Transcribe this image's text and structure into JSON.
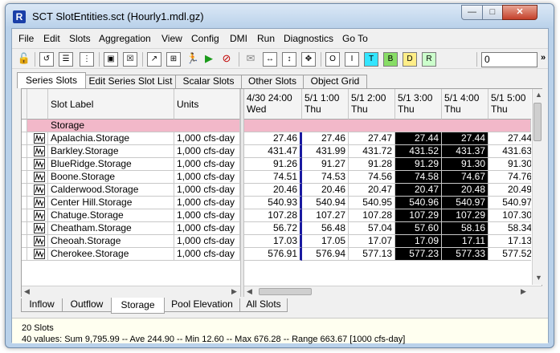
{
  "window": {
    "title": "SCT SlotEntities.sct (Hourly1.mdl.gz)"
  },
  "menu": [
    "File",
    "Edit",
    "Slots",
    "Aggregation",
    "View",
    "Config",
    "DMI",
    "Run",
    "Diagnostics",
    "Go To"
  ],
  "toolbar": {
    "input_value": "0",
    "letter_buttons": [
      "O",
      "I",
      "T",
      "B",
      "D",
      "R"
    ],
    "letter_colors": [
      "#ffffff",
      "#ffffff",
      "#33e5ff",
      "#88dd66",
      "#ffee88",
      "#ccffcc"
    ]
  },
  "top_tabs": [
    "Series Slots",
    "Edit Series Slot List",
    "Scalar Slots",
    "Other Slots",
    "Object Grid"
  ],
  "active_top_tab": "Series Slots",
  "grid": {
    "col_slot_label": "Slot Label",
    "col_units": "Units",
    "group_label": "Storage",
    "columns": [
      {
        "date": "4/30 24:00",
        "day": "Wed"
      },
      {
        "date": "5/1 1:00",
        "day": "Thu"
      },
      {
        "date": "5/1 2:00",
        "day": "Thu"
      },
      {
        "date": "5/1 3:00",
        "day": "Thu"
      },
      {
        "date": "5/1 4:00",
        "day": "Thu"
      },
      {
        "date": "5/1 5:00",
        "day": "Thu"
      }
    ],
    "rows": [
      {
        "label": "Apalachia.Storage",
        "units": "1,000 cfs-day",
        "values": [
          "27.46",
          "27.46",
          "27.47",
          "27.44",
          "27.44",
          "27.44"
        ]
      },
      {
        "label": "Barkley.Storage",
        "units": "1,000 cfs-day",
        "values": [
          "431.47",
          "431.99",
          "431.72",
          "431.52",
          "431.37",
          "431.63"
        ]
      },
      {
        "label": "BlueRidge.Storage",
        "units": "1,000 cfs-day",
        "values": [
          "91.26",
          "91.27",
          "91.28",
          "91.29",
          "91.30",
          "91.30"
        ]
      },
      {
        "label": "Boone.Storage",
        "units": "1,000 cfs-day",
        "values": [
          "74.51",
          "74.53",
          "74.56",
          "74.58",
          "74.67",
          "74.76"
        ]
      },
      {
        "label": "Calderwood.Storage",
        "units": "1,000 cfs-day",
        "values": [
          "20.46",
          "20.46",
          "20.47",
          "20.47",
          "20.48",
          "20.49"
        ]
      },
      {
        "label": "Center Hill.Storage",
        "units": "1,000 cfs-day",
        "values": [
          "540.93",
          "540.94",
          "540.95",
          "540.96",
          "540.97",
          "540.97"
        ]
      },
      {
        "label": "Chatuge.Storage",
        "units": "1,000 cfs-day",
        "values": [
          "107.28",
          "107.27",
          "107.28",
          "107.29",
          "107.29",
          "107.30"
        ]
      },
      {
        "label": "Cheatham.Storage",
        "units": "1,000 cfs-day",
        "values": [
          "56.72",
          "56.48",
          "57.04",
          "57.60",
          "58.16",
          "58.34"
        ]
      },
      {
        "label": "Cheoah.Storage",
        "units": "1,000 cfs-day",
        "values": [
          "17.03",
          "17.05",
          "17.07",
          "17.09",
          "17.11",
          "17.13"
        ]
      },
      {
        "label": "Cherokee.Storage",
        "units": "1,000 cfs-day",
        "values": [
          "576.91",
          "576.94",
          "577.13",
          "577.23",
          "577.33",
          "577.52"
        ]
      }
    ]
  },
  "bottom_tabs": [
    "Inflow",
    "Outflow",
    "Storage",
    "Pool Elevation",
    "All Slots"
  ],
  "active_bottom_tab": "Storage",
  "status": {
    "line1": "20 Slots",
    "line2": "40 values:  Sum 9,795.99 -- Ave 244.90 -- Min 12.60 -- Max 676.28 -- Range 663.67 [1000 cfs-day]"
  }
}
